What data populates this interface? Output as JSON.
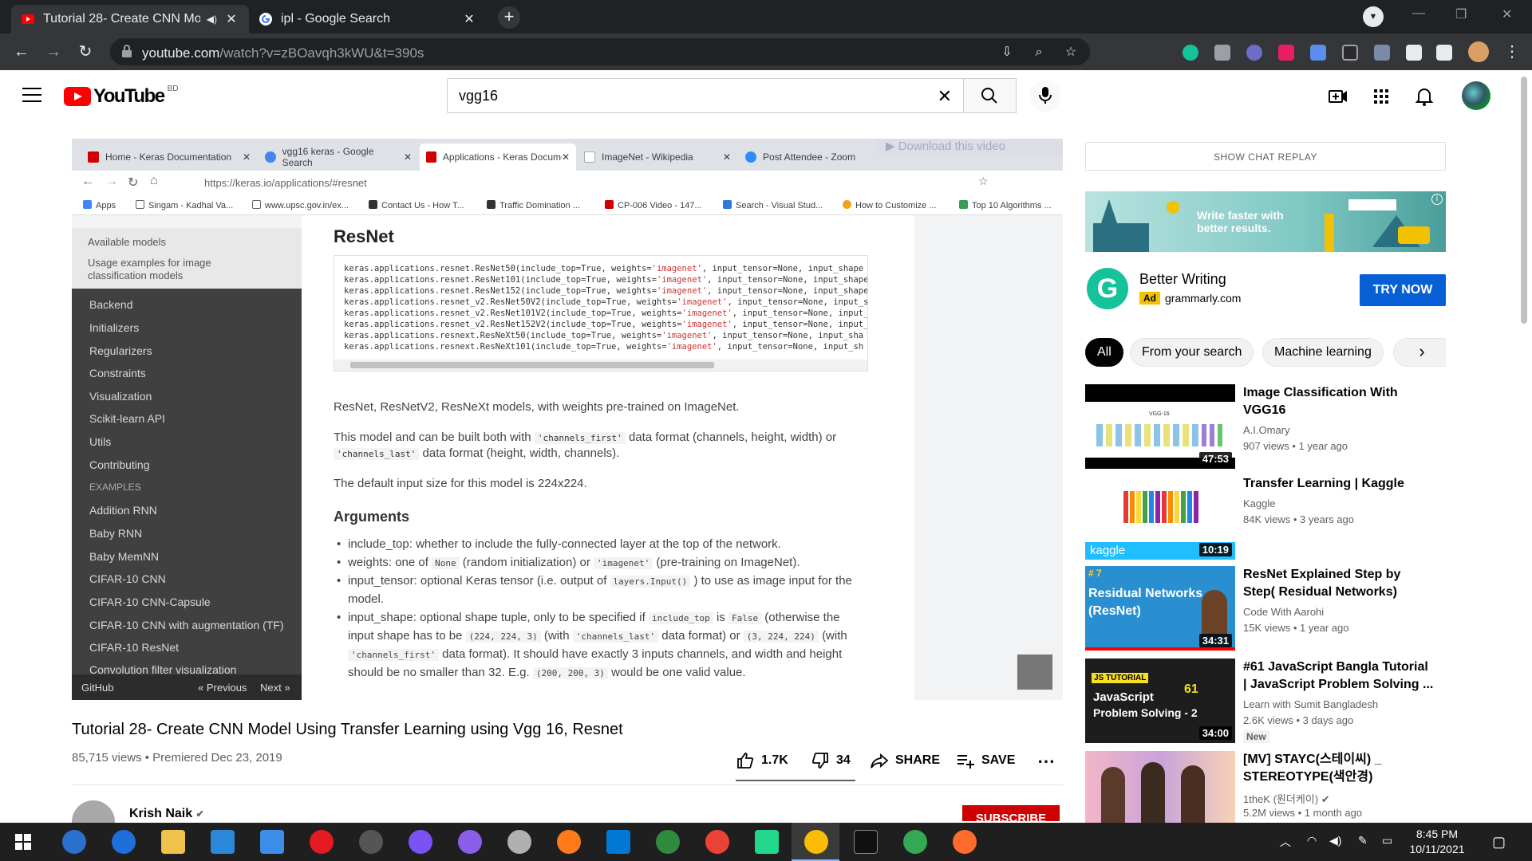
{
  "browser": {
    "tabs": [
      {
        "title": "Tutorial 28- Create CNN Mo",
        "icon": "youtube-icon",
        "audio": true
      },
      {
        "title": "ipl - Google Search",
        "icon": "google-icon"
      }
    ],
    "url_host": "youtube.com",
    "url_path": "/watch?v=zBOavqh3kWU&t=390s"
  },
  "youtube": {
    "country": "BD",
    "search_query": "vgg16"
  },
  "video": {
    "inner_tabs": [
      "Home - Keras Documentation",
      "vgg16 keras - Google Search",
      "Applications - Keras Documen",
      "ImageNet - Wikipedia",
      "Post Attendee - Zoom"
    ],
    "download_banner": "Download this video",
    "inner_url": "https://keras.io/applications/#resnet",
    "bookmarks": [
      "Apps",
      "Singam - Kadhal Va...",
      "www.upsc.gov.in/ex...",
      "Contact Us - How T...",
      "Traffic Domination ...",
      "CP-006 Video - 147...",
      "Search - Visual Stud...",
      "How to Customize ...",
      "Top 10 Algorithms ..."
    ],
    "docs_sidebar_top": [
      "Available models",
      "Usage examples for image",
      "classification models"
    ],
    "docs_sidebar": [
      "Backend",
      "Initializers",
      "Regularizers",
      "Constraints",
      "Visualization",
      "Scikit-learn API",
      "Utils",
      "Contributing",
      "EXAMPLES",
      "Addition RNN",
      "Baby RNN",
      "Baby MemNN",
      "CIFAR-10 CNN",
      "CIFAR-10 CNN-Capsule",
      "CIFAR-10 CNN with augmentation (TF)",
      "CIFAR-10 ResNet",
      "Convolution filter visualization"
    ],
    "docs_nav": {
      "github": "GitHub",
      "prev": "« Previous",
      "next": "Next »"
    },
    "docs_heading": "ResNet",
    "code_lines": [
      {
        "a": "keras.applications.resnet.ResNet50(include_top=True, weights=",
        "b": "'imagenet'",
        "c": ", input_tensor=None, input_shape"
      },
      {
        "a": "keras.applications.resnet.ResNet101(include_top=True, weights=",
        "b": "'imagenet'",
        "c": ", input_tensor=None, input_shape"
      },
      {
        "a": "keras.applications.resnet.ResNet152(include_top=True, weights=",
        "b": "'imagenet'",
        "c": ", input_tensor=None, input_shape"
      },
      {
        "a": "keras.applications.resnet_v2.ResNet50V2(include_top=True, weights=",
        "b": "'imagenet'",
        "c": ", input_tensor=None, input_s"
      },
      {
        "a": "keras.applications.resnet_v2.ResNet101V2(include_top=True, weights=",
        "b": "'imagenet'",
        "c": ", input_tensor=None, input_"
      },
      {
        "a": "keras.applications.resnet_v2.ResNet152V2(include_top=True, weights=",
        "b": "'imagenet'",
        "c": ", input_tensor=None, input_"
      },
      {
        "a": "keras.applications.resnext.ResNeXt50(include_top=True, weights=",
        "b": "'imagenet'",
        "c": ", input_tensor=None, input_sha"
      },
      {
        "a": "keras.applications.resnext.ResNeXt101(include_top=True, weights=",
        "b": "'imagenet'",
        "c": ", input_tensor=None, input_sh"
      }
    ],
    "p1": "ResNet, ResNetV2, ResNeXt models, with weights pre-trained on ImageNet.",
    "p2a": "This model and can be built both with",
    "p2code1": "'channels_first'",
    "p2b": "data format (channels, height, width) or",
    "p2code2": "'channels_last'",
    "p2c": "data format (height, width, channels).",
    "p3": "The default input size for this model is 224x224.",
    "args_heading": "Arguments",
    "b1": "include_top: whether to include the fully-connected layer at the top of the network.",
    "b2a": "weights: one of",
    "b2code1": "None",
    "b2b": "(random initialization) or",
    "b2code2": "'imagenet'",
    "b2c": "(pre-training on ImageNet).",
    "b3a": "input_tensor: optional Keras tensor (i.e. output of",
    "b3code": "layers.Input()",
    "b3b": ") to use as image input for the",
    "b3d": "model.",
    "b4a": "input_shape: optional shape tuple, only to be specified if",
    "b4code1": "include_top",
    "b4b": "is",
    "b4code2": "False",
    "b4c": "(otherwise the",
    "b4d": "input shape has to be",
    "b4code3": "(224, 224, 3)",
    "b4e": "(with",
    "b4code4": "'channels_last'",
    "b4f": "data format) or",
    "b4code5": "(3, 224, 224)",
    "b4g": "(with",
    "b4code6": "'channels_first'",
    "b4h": "data format). It should have exactly 3 inputs channels, and width and height",
    "b4i": "should be no smaller than 32. E.g.",
    "b4code7": "(200, 200, 3)",
    "b4j": "would be one valid value."
  },
  "watch": {
    "title": "Tutorial 28- Create CNN Model Using Transfer Learning using Vgg 16, Resnet",
    "views": "85,715 views",
    "premiered": "Premiered Dec 23, 2019",
    "likes": "1.7K",
    "dislikes": "34",
    "share": "SHARE",
    "save": "SAVE",
    "channel": "Krish Naik",
    "subscribe": "SUBSCRIBE"
  },
  "sidebar": {
    "chat_replay": "SHOW CHAT REPLAY",
    "ad": {
      "banner_text_1": "Write faster with",
      "banner_text_2": "better results.",
      "title": "Better Writing",
      "badge": "Ad",
      "domain": "grammarly.com",
      "cta": "TRY NOW"
    },
    "chips": [
      "All",
      "From your search",
      "Machine learning"
    ],
    "recommendations": [
      {
        "title": "Image Classification With VGG16",
        "channel": "A.I.Omary",
        "meta": "907 views • 1 year ago",
        "duration": "47:53"
      },
      {
        "title": "Transfer Learning | Kaggle",
        "channel": "Kaggle",
        "meta": "84K views • 3 years ago",
        "duration": "10:19"
      },
      {
        "title": "ResNet Explained Step by Step( Residual Networks)",
        "channel": "Code With Aarohi",
        "meta": "15K views • 1 year ago",
        "duration": "34:31"
      },
      {
        "title": "#61 JavaScript Bangla Tutorial | JavaScript Problem Solving ...",
        "channel": "Learn with Sumit Bangladesh",
        "meta": "2.6K views • 3 days ago",
        "duration": "34:00",
        "badge": "New"
      },
      {
        "title": "[MV] STAYC(스테이씨) _ STEREOTYPE(색안경)",
        "channel": "1theK (원더케이)",
        "meta": "5.2M views • 1 month ago"
      }
    ],
    "thumb_text": {
      "vgg_label": "VGG-16",
      "kaggle_label": "kaggle",
      "resnet_num": "# 7",
      "resnet_line1": "Residual Networks",
      "resnet_line2": "(ResNet)",
      "js_tag": "JS TUTORIAL",
      "js_num": "61",
      "js_line1": "JavaScript",
      "js_line2": "Problem Solving - 2"
    }
  },
  "taskbar": {
    "time": "8:45 PM",
    "date": "10/11/2021"
  }
}
